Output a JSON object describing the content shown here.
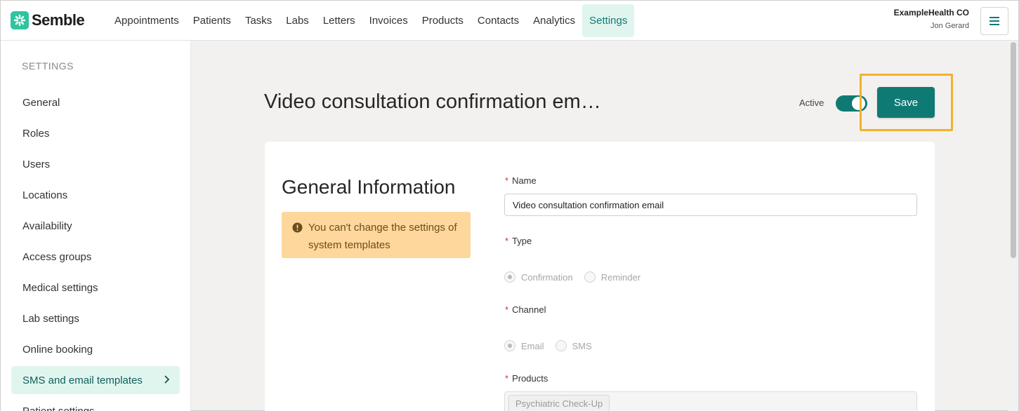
{
  "brand": {
    "name": "Semble",
    "accent": "#0f7a74",
    "logo_color": "#2fc4a0"
  },
  "nav": {
    "items": [
      {
        "label": "Appointments"
      },
      {
        "label": "Patients"
      },
      {
        "label": "Tasks"
      },
      {
        "label": "Labs"
      },
      {
        "label": "Letters"
      },
      {
        "label": "Invoices"
      },
      {
        "label": "Products"
      },
      {
        "label": "Contacts"
      },
      {
        "label": "Analytics"
      },
      {
        "label": "Settings",
        "active": true
      }
    ]
  },
  "account": {
    "org": "ExampleHealth CO",
    "user": "Jon Gerard",
    "menu_icon": "hamburger-icon"
  },
  "sidebar": {
    "heading": "SETTINGS",
    "items": [
      {
        "label": "General"
      },
      {
        "label": "Roles"
      },
      {
        "label": "Users"
      },
      {
        "label": "Locations"
      },
      {
        "label": "Availability"
      },
      {
        "label": "Access groups"
      },
      {
        "label": "Medical settings"
      },
      {
        "label": "Lab settings"
      },
      {
        "label": "Online booking"
      },
      {
        "label": "SMS and email templates",
        "active": true
      },
      {
        "label": "Patient settings"
      }
    ]
  },
  "header": {
    "title": "Video consultation confirmation em…",
    "active_label": "Active",
    "active": true,
    "save_label": "Save",
    "highlight_color": "#f2b12c"
  },
  "general": {
    "title": "General Information",
    "warning": "You can't change the settings of system templates",
    "warning_icon": "exclamation-circle-icon",
    "name_label": "Name",
    "name_value": "Video consultation confirmation email",
    "type_label": "Type",
    "type_options": [
      "Confirmation",
      "Reminder"
    ],
    "type_selected": "Confirmation",
    "channel_label": "Channel",
    "channel_options": [
      "Email",
      "SMS"
    ],
    "channel_selected": "Email",
    "products_label": "Products",
    "products": [
      "Psychiatric Check-Up"
    ],
    "required_marker": "*"
  }
}
